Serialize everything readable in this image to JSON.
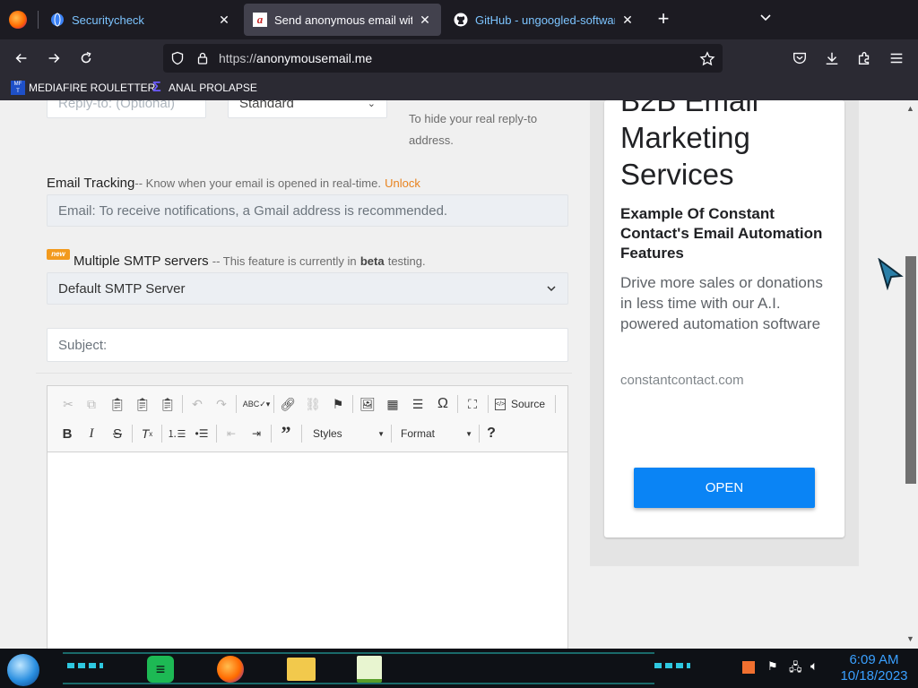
{
  "browser": {
    "tabs": [
      {
        "title": "Securitycheck",
        "active": false
      },
      {
        "title": "Send anonymous email with th",
        "active": true
      },
      {
        "title": "GitHub - ungoogled-software/",
        "active": false
      }
    ],
    "url_prefix": "https://",
    "url_domain": "anonymousemail.me",
    "bookmarks": [
      {
        "label": "MEDIAFIRE ROULETTER"
      },
      {
        "label": "ANAL PROLAPSE"
      }
    ]
  },
  "form": {
    "reply_to_placeholder": "Reply-to: (Optional)",
    "reply_type_value": "Standard",
    "reply_hint": "To hide your real reply-to address.",
    "email_tracking_label": "Email Tracking",
    "email_tracking_hint": "-- Know when your email is opened in real-time.",
    "email_tracking_unlock": "Unlock",
    "email_tracking_placeholder": "Email: To receive notifications, a Gmail address is recommended.",
    "smtp_badge": "new",
    "smtp_label": "Multiple SMTP servers",
    "smtp_hint_pre": "-- This feature is currently in",
    "smtp_hint_bold": "beta",
    "smtp_hint_post": "testing.",
    "smtp_value": "Default SMTP Server",
    "subject_placeholder": "Subject:"
  },
  "editor": {
    "source_label": "Source",
    "styles_label": "Styles",
    "format_label": "Format",
    "help_label": "?"
  },
  "ad": {
    "title": "B2B Email Marketing Services",
    "subtitle": "Example Of Constant Contact's Email Automation Features",
    "body": "Drive more sales or donations in less time with our A.I. powered automation software",
    "domain": "constantcontact.com",
    "button": "OPEN"
  },
  "taskbar": {
    "time": "6:09 AM",
    "date": "10/18/2023"
  },
  "colors": {
    "accent_orange": "#e8821d",
    "ad_button": "#0a84f5",
    "clock": "#3aa0ff"
  }
}
